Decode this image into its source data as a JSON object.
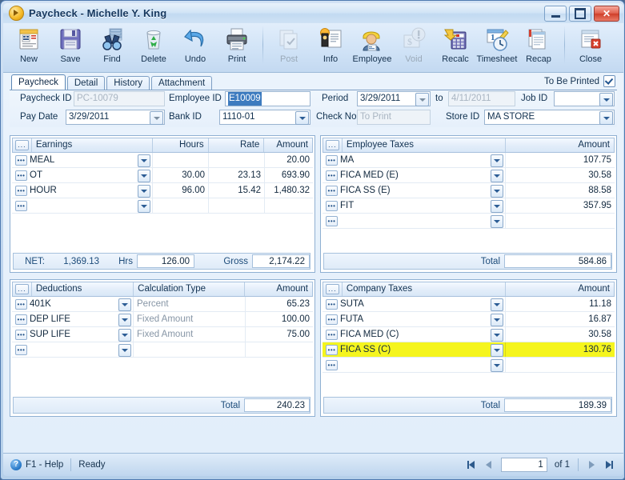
{
  "window": {
    "title": "Paycheck - Michelle Y. King",
    "app_icon": "play-orb-icon",
    "minimize_label": "Minimize",
    "maximize_label": "Restore",
    "close_label": "Close"
  },
  "toolbar": {
    "buttons": [
      {
        "label": "New",
        "icon": "new-document-icon",
        "disabled": false
      },
      {
        "label": "Save",
        "icon": "floppy-disk-icon",
        "disabled": false
      },
      {
        "label": "Find",
        "icon": "binoculars-icon",
        "disabled": false
      },
      {
        "label": "Delete",
        "icon": "recycle-bin-icon",
        "disabled": false
      },
      {
        "label": "Undo",
        "icon": "undo-arrow-icon",
        "disabled": false
      },
      {
        "label": "Print",
        "icon": "printer-icon",
        "disabled": false
      },
      {
        "label": "Post",
        "icon": "post-icon",
        "disabled": true
      },
      {
        "label": "Info",
        "icon": "info-icon",
        "disabled": false
      },
      {
        "label": "Employee",
        "icon": "employee-icon",
        "disabled": false
      },
      {
        "label": "Void",
        "icon": "void-icon",
        "disabled": true
      },
      {
        "label": "Recalc",
        "icon": "calculator-icon",
        "disabled": false
      },
      {
        "label": "Timesheet",
        "icon": "timesheet-icon",
        "disabled": false
      },
      {
        "label": "Recap",
        "icon": "recap-icon",
        "disabled": false
      },
      {
        "label": "Close",
        "icon": "close-window-icon",
        "disabled": false
      }
    ]
  },
  "tabs": [
    {
      "label": "Paycheck",
      "active": true
    },
    {
      "label": "Detail",
      "active": false
    },
    {
      "label": "History",
      "active": false
    },
    {
      "label": "Attachment",
      "active": false
    }
  ],
  "to_be_printed": {
    "label": "To Be Printed",
    "checked": true
  },
  "form": {
    "paycheck_id": {
      "label": "Paycheck ID",
      "value": "PC-10079",
      "readonly": true
    },
    "employee_id": {
      "label": "Employee ID",
      "value": "E10009",
      "selected": true
    },
    "period": {
      "label": "Period",
      "value": "3/29/2011"
    },
    "period_to": {
      "label": "to",
      "value": "4/11/2011",
      "readonly": true
    },
    "job_id": {
      "label": "Job ID",
      "value": ""
    },
    "pay_date": {
      "label": "Pay Date",
      "value": "3/29/2011"
    },
    "bank_id": {
      "label": "Bank ID",
      "value": "1110-01"
    },
    "check_no": {
      "label": "Check No",
      "value": "To Print",
      "readonly": true
    },
    "store_id": {
      "label": "Store ID",
      "value": "MA STORE"
    }
  },
  "earnings": {
    "headers": [
      "Earnings",
      "Hours",
      "Rate",
      "Amount"
    ],
    "rows": [
      {
        "code": "MEAL",
        "hours": "",
        "rate": "",
        "amount": "20.00"
      },
      {
        "code": "OT",
        "hours": "30.00",
        "rate": "23.13",
        "amount": "693.90"
      },
      {
        "code": "HOUR",
        "hours": "96.00",
        "rate": "15.42",
        "amount": "1,480.32"
      },
      {
        "code": "",
        "hours": "",
        "rate": "",
        "amount": ""
      }
    ],
    "footer": {
      "net_label": "NET:",
      "net_value": "1,369.13",
      "hrs_label": "Hrs",
      "hrs_value": "126.00",
      "gross_label": "Gross",
      "gross_value": "2,174.22"
    }
  },
  "employee_taxes": {
    "headers": [
      "Employee Taxes",
      "Amount"
    ],
    "rows": [
      {
        "code": "MA",
        "amount": "107.75"
      },
      {
        "code": "FICA MED (E)",
        "amount": "30.58"
      },
      {
        "code": "FICA SS (E)",
        "amount": "88.58"
      },
      {
        "code": "FIT",
        "amount": "357.95"
      },
      {
        "code": "",
        "amount": ""
      }
    ],
    "footer": {
      "total_label": "Total",
      "total_value": "584.86"
    }
  },
  "deductions": {
    "headers": [
      "Deductions",
      "Calculation Type",
      "Amount"
    ],
    "rows": [
      {
        "code": "401K",
        "calc": "Percent",
        "amount": "65.23"
      },
      {
        "code": "DEP LIFE",
        "calc": "Fixed Amount",
        "amount": "100.00"
      },
      {
        "code": "SUP LIFE",
        "calc": "Fixed Amount",
        "amount": "75.00"
      },
      {
        "code": "",
        "calc": "",
        "amount": ""
      }
    ],
    "footer": {
      "total_label": "Total",
      "total_value": "240.23"
    }
  },
  "company_taxes": {
    "headers": [
      "Company Taxes",
      "Amount"
    ],
    "rows": [
      {
        "code": "SUTA",
        "amount": "11.18",
        "highlight": false
      },
      {
        "code": "FUTA",
        "amount": "16.87",
        "highlight": false
      },
      {
        "code": "FICA MED (C)",
        "amount": "30.58",
        "highlight": false
      },
      {
        "code": "FICA SS (C)",
        "amount": "130.76",
        "highlight": true
      },
      {
        "code": "",
        "amount": "",
        "highlight": false
      }
    ],
    "footer": {
      "total_label": "Total",
      "total_value": "189.39"
    }
  },
  "statusbar": {
    "help_label": "F1 - Help",
    "status": "Ready",
    "record_current": "1",
    "record_of": "of 1"
  },
  "colors": {
    "highlight_row": "#f5f51e",
    "selection_blue": "#3d7bbf",
    "accent": "#4f7ab0"
  }
}
